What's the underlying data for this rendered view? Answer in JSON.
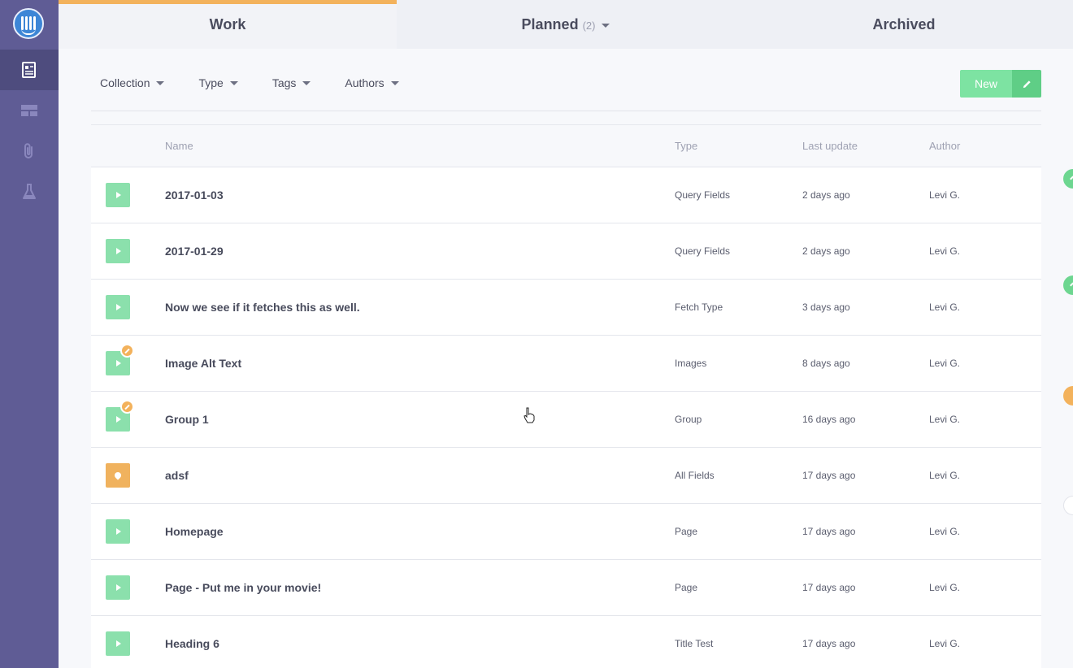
{
  "tabs": [
    {
      "label": "Work",
      "active": true
    },
    {
      "label": "Planned",
      "count": "(2)",
      "active": false
    },
    {
      "label": "Archived",
      "active": false
    }
  ],
  "filters": {
    "collection": "Collection",
    "type": "Type",
    "tags": "Tags",
    "authors": "Authors"
  },
  "new_button": {
    "label": "New"
  },
  "table": {
    "headers": {
      "name": "Name",
      "type": "Type",
      "last_update": "Last update",
      "author": "Author"
    },
    "rows": [
      {
        "name": "2017-01-03",
        "type": "Query Fields",
        "last_update": "2 days ago",
        "author": "Levi G.",
        "icon": "play",
        "edited": false,
        "status": "green"
      },
      {
        "name": "2017-01-29",
        "type": "Query Fields",
        "last_update": "2 days ago",
        "author": "Levi G.",
        "icon": "play",
        "edited": false,
        "status": "green"
      },
      {
        "name": "Now we see if it fetches this as well.",
        "type": "Fetch Type",
        "last_update": "3 days ago",
        "author": "Levi G.",
        "icon": "play",
        "edited": false,
        "status": "green"
      },
      {
        "name": "Image Alt Text",
        "type": "Images",
        "last_update": "8 days ago",
        "author": "Levi G.",
        "icon": "play",
        "edited": true,
        "status": "green"
      },
      {
        "name": "Group 1",
        "type": "Group",
        "last_update": "16 days ago",
        "author": "Levi G.",
        "icon": "play",
        "edited": true,
        "status": "green"
      },
      {
        "name": "adsf",
        "type": "All Fields",
        "last_update": "17 days ago",
        "author": "Levi G.",
        "icon": "draft",
        "edited": false,
        "status": "orange"
      },
      {
        "name": "Homepage",
        "type": "Page",
        "last_update": "17 days ago",
        "author": "Levi G.",
        "icon": "play",
        "edited": false,
        "status": "green"
      },
      {
        "name": "Page - Put me in your movie!",
        "type": "Page",
        "last_update": "17 days ago",
        "author": "Levi G.",
        "icon": "play",
        "edited": false,
        "status": "green"
      },
      {
        "name": "Heading 6",
        "type": "Title Test",
        "last_update": "17 days ago",
        "author": "Levi G.",
        "icon": "play",
        "edited": false,
        "status": "green"
      }
    ]
  },
  "sidebar": {
    "items": [
      {
        "icon": "documents-icon",
        "active": true
      },
      {
        "icon": "layout-icon",
        "active": false
      },
      {
        "icon": "paperclip-icon",
        "active": false
      },
      {
        "icon": "flask-icon",
        "active": false
      }
    ]
  },
  "colors": {
    "sidebar": "#5f5c95",
    "accent_tab": "#f3b25c",
    "published": "#8be0ac",
    "draft": "#f0b25e",
    "new_button": "#7de3a2"
  }
}
